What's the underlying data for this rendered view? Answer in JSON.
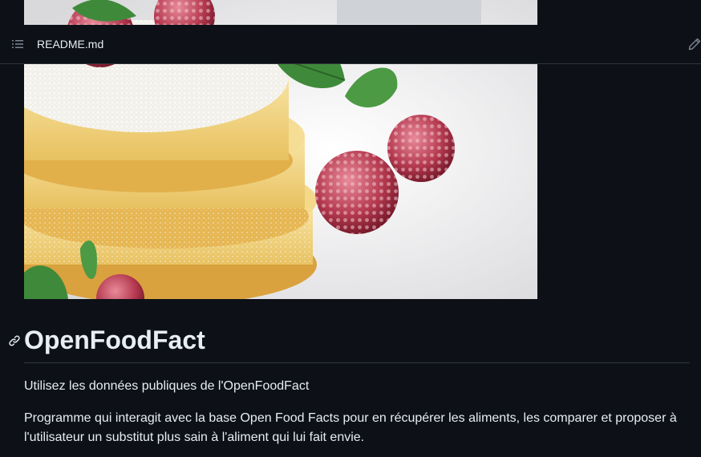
{
  "file_header": {
    "file_name": "README.md",
    "toc_icon": "list-unordered-icon",
    "edit_icon": "pencil-icon"
  },
  "readme": {
    "hero_image": "pancakes-with-raspberries-photo",
    "heading": "OpenFoodFact",
    "anchor_icon": "link-icon",
    "paragraphs": [
      "Utilisez les données publiques de l'OpenFoodFact",
      "Programme qui interagit avec la base Open Food Facts pour en récupérer les aliments, les comparer et proposer à l'utilisateur un substitut plus sain à l'aliment qui lui fait envie."
    ]
  },
  "colors": {
    "background": "#0d1117",
    "border": "#30363d",
    "text": "#e6edf3",
    "icon": "#7d8590"
  }
}
